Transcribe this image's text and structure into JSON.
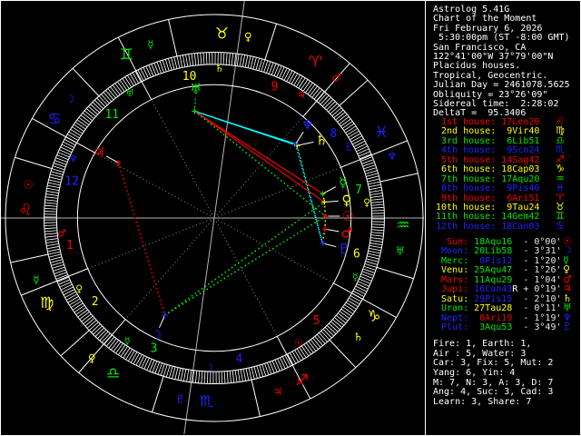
{
  "colors": {
    "red": "#f40000",
    "yellow": "#ffff00",
    "green": "#00e800",
    "blue": "#2121ff",
    "cyan": "#00ffff",
    "white": "#ffffff",
    "gray": "#b4b4b4",
    "dim": "#8e8e8e",
    "vel": "#e6e6e6"
  },
  "info_lines": [
    "Astrolog 5.41G",
    "Chart of the Moment",
    "Fri February 6, 2026",
    " 5:30:00pm (ST -8:00 GMT)",
    "San Francisco, CA",
    "122°41'00\"W 37°79'00\"N",
    "Placidus houses.",
    "Tropical, Geocentric.",
    "Julian Day = 2461078.5625",
    "Obliquity = 23°26'09\"",
    "Sidereal time:  2:28:02",
    "DeltaT =  95.3406"
  ],
  "houses": [
    {
      "label": "1st",
      "value": "17Leo20",
      "color": "red",
      "sign_glyph": "♌",
      "sign_color": "red",
      "cusp_lon": 137.333
    },
    {
      "label": "2nd",
      "value": " 9Vir40",
      "color": "yellow",
      "sign_glyph": "♍",
      "sign_color": "yellow",
      "cusp_lon": 159.667
    },
    {
      "label": "3rd",
      "value": " 6Lib51",
      "color": "green",
      "sign_glyph": "♎",
      "sign_color": "green",
      "cusp_lon": 186.85
    },
    {
      "label": "4th",
      "value": " 9Sco24",
      "color": "blue",
      "sign_glyph": "♏",
      "sign_color": "blue",
      "cusp_lon": 219.4
    },
    {
      "label": "5th",
      "value": "14Sag42",
      "color": "red",
      "sign_glyph": "♐",
      "sign_color": "red",
      "cusp_lon": 254.7
    },
    {
      "label": "6th",
      "value": "18Cap03",
      "color": "yellow",
      "sign_glyph": "♑",
      "sign_color": "yellow",
      "cusp_lon": 288.05
    },
    {
      "label": "7th",
      "value": "17Aqu20",
      "color": "green",
      "sign_glyph": "♒",
      "sign_color": "green",
      "cusp_lon": 317.333
    },
    {
      "label": "8th",
      "value": " 9Pis40",
      "color": "blue",
      "sign_glyph": "♓",
      "sign_color": "blue",
      "cusp_lon": 339.667
    },
    {
      "label": "9th",
      "value": " 6Ari51",
      "color": "red",
      "sign_glyph": "♈",
      "sign_color": "red",
      "cusp_lon": 6.85
    },
    {
      "label": "10th",
      "value": " 9Tau24",
      "color": "yellow",
      "sign_glyph": "♉",
      "sign_color": "yellow",
      "cusp_lon": 39.4
    },
    {
      "label": "11th",
      "value": "14Gem42",
      "color": "green",
      "sign_glyph": "♊",
      "sign_color": "green",
      "cusp_lon": 74.7
    },
    {
      "label": "12th",
      "value": "18Can03",
      "color": "blue",
      "sign_glyph": "♋",
      "sign_color": "blue",
      "cusp_lon": 108.05
    }
  ],
  "planets": [
    {
      "name": "Sun",
      "value": "18Aqu16",
      "retro": "",
      "velocity": "- 0°00'",
      "color": "red",
      "value_color": "green",
      "glyph": "☉",
      "lon": 318.267,
      "disp_phi": 0.8
    },
    {
      "name": "Moon",
      "value": "20Lib58",
      "retro": "",
      "velocity": "- 3°31'",
      "color": "blue",
      "value_color": "green",
      "glyph": "☽",
      "lon": 200.967,
      "disp_phi": 244.2
    },
    {
      "name": "Merc",
      "value": " 0Pis12",
      "retro": "",
      "velocity": "- 1°20'",
      "color": "green",
      "value_color": "blue",
      "glyph": "☿",
      "lon": 330.2,
      "disp_phi": 15.7
    },
    {
      "name": "Venu",
      "value": "25Aqu47",
      "retro": "",
      "velocity": "- 1°26'",
      "color": "yellow",
      "value_color": "green",
      "glyph": "♀",
      "lon": 325.783,
      "disp_phi": 7.8
    },
    {
      "name": "Mars",
      "value": "11Aqu29",
      "retro": "",
      "velocity": "- 1°04'",
      "color": "red",
      "value_color": "green",
      "glyph": "♂",
      "lon": 311.483,
      "disp_phi": 353.4
    },
    {
      "name": "Jupi",
      "value": "16Can43",
      "retro": "R",
      "velocity": "+ 0°19'",
      "color": "red",
      "value_color": "blue",
      "glyph": "♃",
      "lon": 106.717,
      "disp_phi": 149.6
    },
    {
      "name": "Satu",
      "value": "29Pis15",
      "retro": "",
      "velocity": "- 2°10'",
      "color": "yellow",
      "value_color": "blue",
      "glyph": "♄",
      "lon": 359.25,
      "disp_phi": 36.6
    },
    {
      "name": "Uran",
      "value": "27Tau28",
      "retro": "",
      "velocity": "- 0°11'",
      "color": "green",
      "value_color": "yellow",
      "glyph": "♅",
      "lon": 57.467,
      "disp_phi": 97.9
    },
    {
      "name": "Nept",
      "value": " 0Ari19",
      "retro": "",
      "velocity": "- 1°19'",
      "color": "blue",
      "value_color": "red",
      "glyph": "♆",
      "lon": 0.317,
      "disp_phi": 45.6
    },
    {
      "name": "Plut",
      "value": " 3Aqu53",
      "retro": "",
      "velocity": "- 3°49'",
      "color": "blue",
      "value_color": "green",
      "glyph": "♇",
      "lon": 303.883,
      "disp_phi": 346.3
    }
  ],
  "stats_lines": [
    "Fire: 1, Earth: 1,",
    "Air : 5, Water: 3",
    "Car: 3, Fix: 5, Mut: 2",
    "Yang: 6, Yin: 4",
    "M: 7, N: 3, A: 3, D: 7",
    "Ang: 4, Suc: 3, Cad: 3",
    "Learn: 3, Share: 7"
  ],
  "wheel": {
    "rotation_deg": 42.667,
    "signs": [
      {
        "name": "Aries",
        "glyph": "♈",
        "color": "red",
        "ruler_glyph": "♂",
        "ruler_color": "red"
      },
      {
        "name": "Taurus",
        "glyph": "♉",
        "color": "yellow",
        "ruler_glyph": "♀",
        "ruler_color": "yellow"
      },
      {
        "name": "Gemini",
        "glyph": "♊",
        "color": "green",
        "ruler_glyph": "☿",
        "ruler_color": "green"
      },
      {
        "name": "Cancer",
        "glyph": "♋",
        "color": "blue",
        "ruler_glyph": "☽",
        "ruler_color": "blue"
      },
      {
        "name": "Leo",
        "glyph": "♌",
        "color": "red",
        "ruler_glyph": "☉",
        "ruler_color": "red"
      },
      {
        "name": "Virgo",
        "glyph": "♍",
        "color": "yellow",
        "ruler_glyph": "☿",
        "ruler_color": "green"
      },
      {
        "name": "Libra",
        "glyph": "♎",
        "color": "green",
        "ruler_glyph": "♀",
        "ruler_color": "yellow"
      },
      {
        "name": "Scorpio",
        "glyph": "♏",
        "color": "blue",
        "ruler_glyph": "♇",
        "ruler_color": "blue"
      },
      {
        "name": "Sagittarius",
        "glyph": "♐",
        "color": "red",
        "ruler_glyph": "♃",
        "ruler_color": "red"
      },
      {
        "name": "Capricorn",
        "glyph": "♑",
        "color": "yellow",
        "ruler_glyph": "♄",
        "ruler_color": "yellow"
      },
      {
        "name": "Aquarius",
        "glyph": "♒",
        "color": "green",
        "ruler_glyph": "♅",
        "ruler_color": "green"
      },
      {
        "name": "Pisces",
        "glyph": "♓",
        "color": "blue",
        "ruler_glyph": "♆",
        "ruler_color": "blue"
      }
    ],
    "house_numbers": [
      "1",
      "2",
      "3",
      "4",
      "5",
      "6",
      "7",
      "8",
      "9",
      "10",
      "11",
      "12"
    ],
    "house_number_colors": [
      "red",
      "yellow",
      "green",
      "blue",
      "red",
      "yellow",
      "green",
      "blue",
      "red",
      "yellow",
      "green",
      "blue"
    ],
    "house_ruler_glyphs": [
      {
        "glyph": "♂",
        "color": "red"
      },
      {
        "glyph": "♀",
        "color": "yellow"
      },
      {
        "glyph": "☿",
        "color": "green"
      },
      {
        "glyph": "☽",
        "color": "blue"
      },
      {
        "glyph": "☉",
        "color": "red"
      },
      {
        "glyph": "☿",
        "color": "green"
      },
      {
        "glyph": "♀",
        "color": "yellow"
      },
      {
        "glyph": "♇",
        "color": "blue"
      },
      {
        "glyph": "♃",
        "color": "red"
      },
      {
        "glyph": "♄",
        "color": "yellow"
      },
      {
        "glyph": "♅",
        "color": "green"
      },
      {
        "glyph": "♆",
        "color": "blue"
      }
    ],
    "aspects": [
      {
        "a": "Uran",
        "b": "Satu",
        "color": "cyan",
        "style": "solid"
      },
      {
        "a": "Uran",
        "b": "Nept",
        "color": "cyan",
        "style": "solid"
      },
      {
        "a": "Satu",
        "b": "Plut",
        "color": "cyan",
        "style": "dotted"
      },
      {
        "a": "Nept",
        "b": "Plut",
        "color": "cyan",
        "style": "dotted"
      },
      {
        "a": "Uran",
        "b": "Merc",
        "color": "red",
        "style": "solid"
      },
      {
        "a": "Uran",
        "b": "Venu",
        "color": "red",
        "style": "solid"
      },
      {
        "a": "Uran",
        "b": "Sun",
        "color": "green",
        "style": "dotted"
      },
      {
        "a": "Jupi",
        "b": "Moon",
        "color": "red",
        "style": "dotted"
      },
      {
        "a": "Moon",
        "b": "Sun",
        "color": "green",
        "style": "dotted"
      },
      {
        "a": "Moon",
        "b": "Venu",
        "color": "green",
        "style": "dotted"
      },
      {
        "a": "Merc",
        "b": "Venu",
        "color": "yellow",
        "style": "dotted"
      },
      {
        "a": "Venu",
        "b": "Sun",
        "color": "yellow",
        "style": "dotted"
      },
      {
        "a": "Sun",
        "b": "Mars",
        "color": "yellow",
        "style": "dotted"
      },
      {
        "a": "Mars",
        "b": "Plut",
        "color": "yellow",
        "style": "dotted"
      }
    ]
  }
}
